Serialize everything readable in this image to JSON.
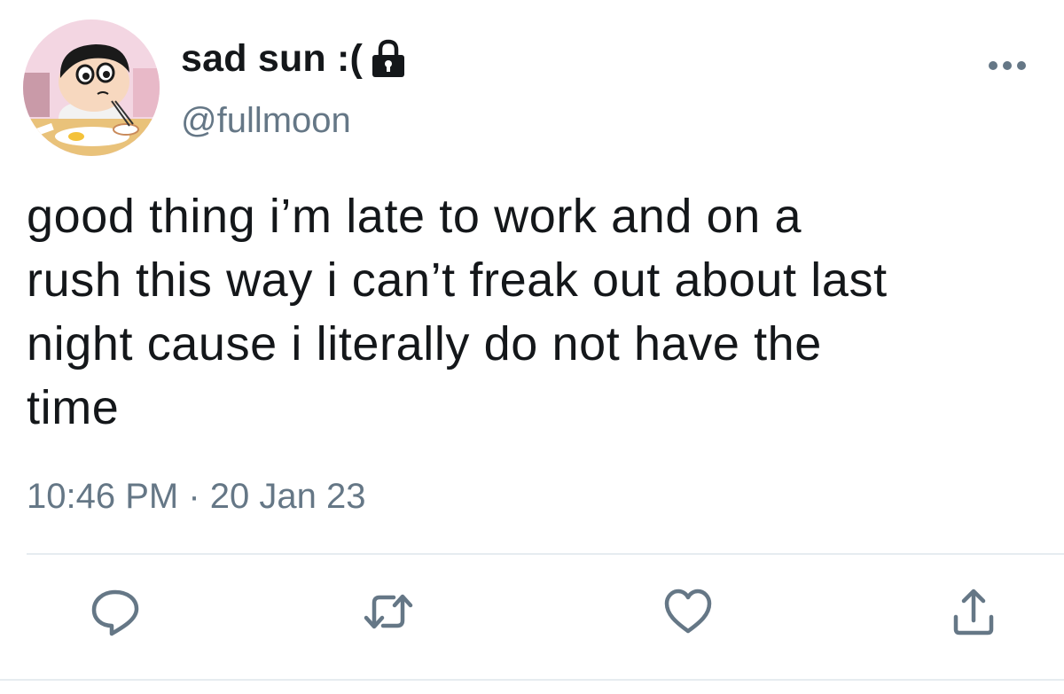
{
  "user": {
    "display_name": "sad sun :(",
    "handle": "@fullmoon",
    "avatar_icon": "cartoon-boy-avatar",
    "protected_icon": "lock-icon"
  },
  "tweet": {
    "text": "good thing i’m late to work and on a\nrush this way i can’t freak out about last\nnight cause i literally do not have the\ntime",
    "timestamp": "10:46 PM · 20 Jan 23"
  },
  "actions": {
    "reply_icon": "reply-icon",
    "retweet_icon": "retweet-icon",
    "like_icon": "heart-icon",
    "share_icon": "share-icon",
    "more_icon": "more-dots-icon"
  },
  "colors": {
    "text_primary": "#14171a",
    "text_secondary": "#657786",
    "divider": "#e6ecf0"
  }
}
